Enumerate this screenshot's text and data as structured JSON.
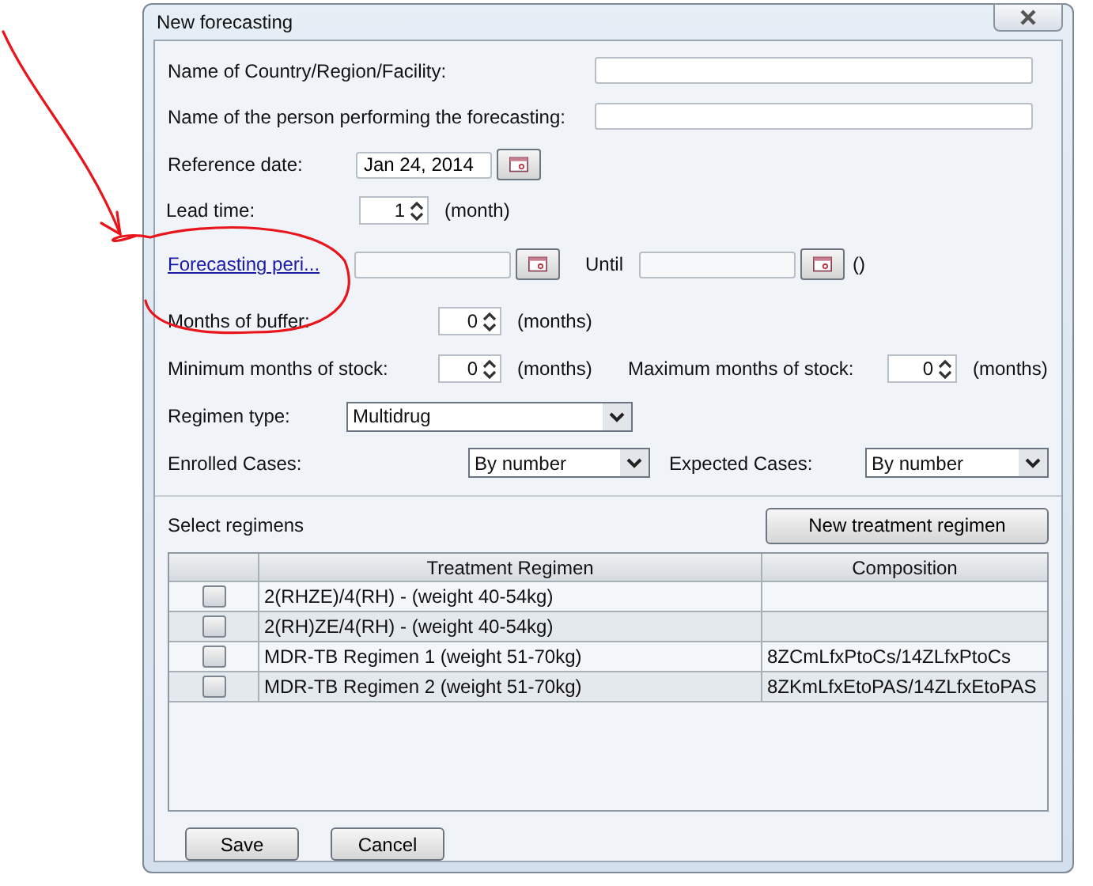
{
  "window": {
    "title": "New forecasting"
  },
  "country": {
    "label": "Name of Country/Region/Facility:"
  },
  "person": {
    "label": "Name of the person performing the forecasting:"
  },
  "reference_date": {
    "label": "Reference date:",
    "value": "Jan 24, 2014"
  },
  "lead_time": {
    "label": "Lead time:",
    "value": "1",
    "unit": "(month)"
  },
  "forecasting_period": {
    "link": "Forecasting peri...",
    "until_label": "Until",
    "suffix": "()"
  },
  "months_of_buffer": {
    "label": "Months of buffer:",
    "value": "0",
    "unit": "(months)"
  },
  "min_stock": {
    "label": "Minimum months of stock:",
    "value": "0",
    "unit": "(months)"
  },
  "max_stock": {
    "label": "Maximum months of stock:",
    "value": "0",
    "unit": "(months)"
  },
  "regimen_type": {
    "label": "Regimen type:",
    "value": "Multidrug"
  },
  "enrolled_cases": {
    "label": "Enrolled Cases:",
    "value": "By number"
  },
  "expected_cases": {
    "label": "Expected Cases:",
    "value": "By number"
  },
  "regimens": {
    "label": "Select regimens",
    "new_button": "New treatment regimen",
    "columns": [
      "Treatment Regimen",
      "Composition"
    ],
    "rows": [
      {
        "checked": false,
        "regimen": "2(RHZE)/4(RH) - (weight 40-54kg)"
      },
      {
        "checked": false,
        "regimen": "2(RH)ZE/4(RH) - (weight 40-54kg)"
      },
      {
        "checked": false,
        "regimen": "MDR-TB Regimen 1 (weight 51-70kg)",
        "composition": "8ZCmLfxPtoCs/14ZLfxPtoCs"
      },
      {
        "checked": false,
        "regimen": "MDR-TB Regimen 2 (weight 51-70kg)",
        "composition": "8ZKmLfxEtoPAS/14ZLfxEtoPAS"
      }
    ]
  },
  "buttons": [
    "Save",
    "Cancel"
  ]
}
